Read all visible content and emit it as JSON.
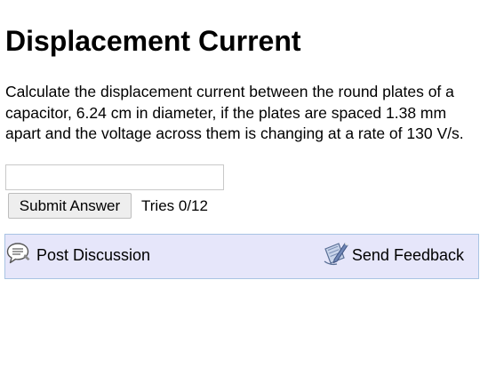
{
  "page": {
    "title": "Displacement Current"
  },
  "question": {
    "text": "Calculate the displacement current between the round plates of a capacitor, 6.24 cm in diameter, if the plates are spaced 1.38 mm apart and the voltage across them is changing at a rate of 130 V/s."
  },
  "answer": {
    "value": "",
    "placeholder": ""
  },
  "actions": {
    "submit_label": "Submit Answer",
    "tries": "Tries 0/12"
  },
  "discussion_bar": {
    "post_label": "Post Discussion",
    "post_icon": "speech-bubble-icon",
    "feedback_label": "Send Feedback",
    "feedback_icon": "feedback-pencil-icon",
    "background_color": "#e6e6fa",
    "border_color": "#a9c4e3"
  }
}
